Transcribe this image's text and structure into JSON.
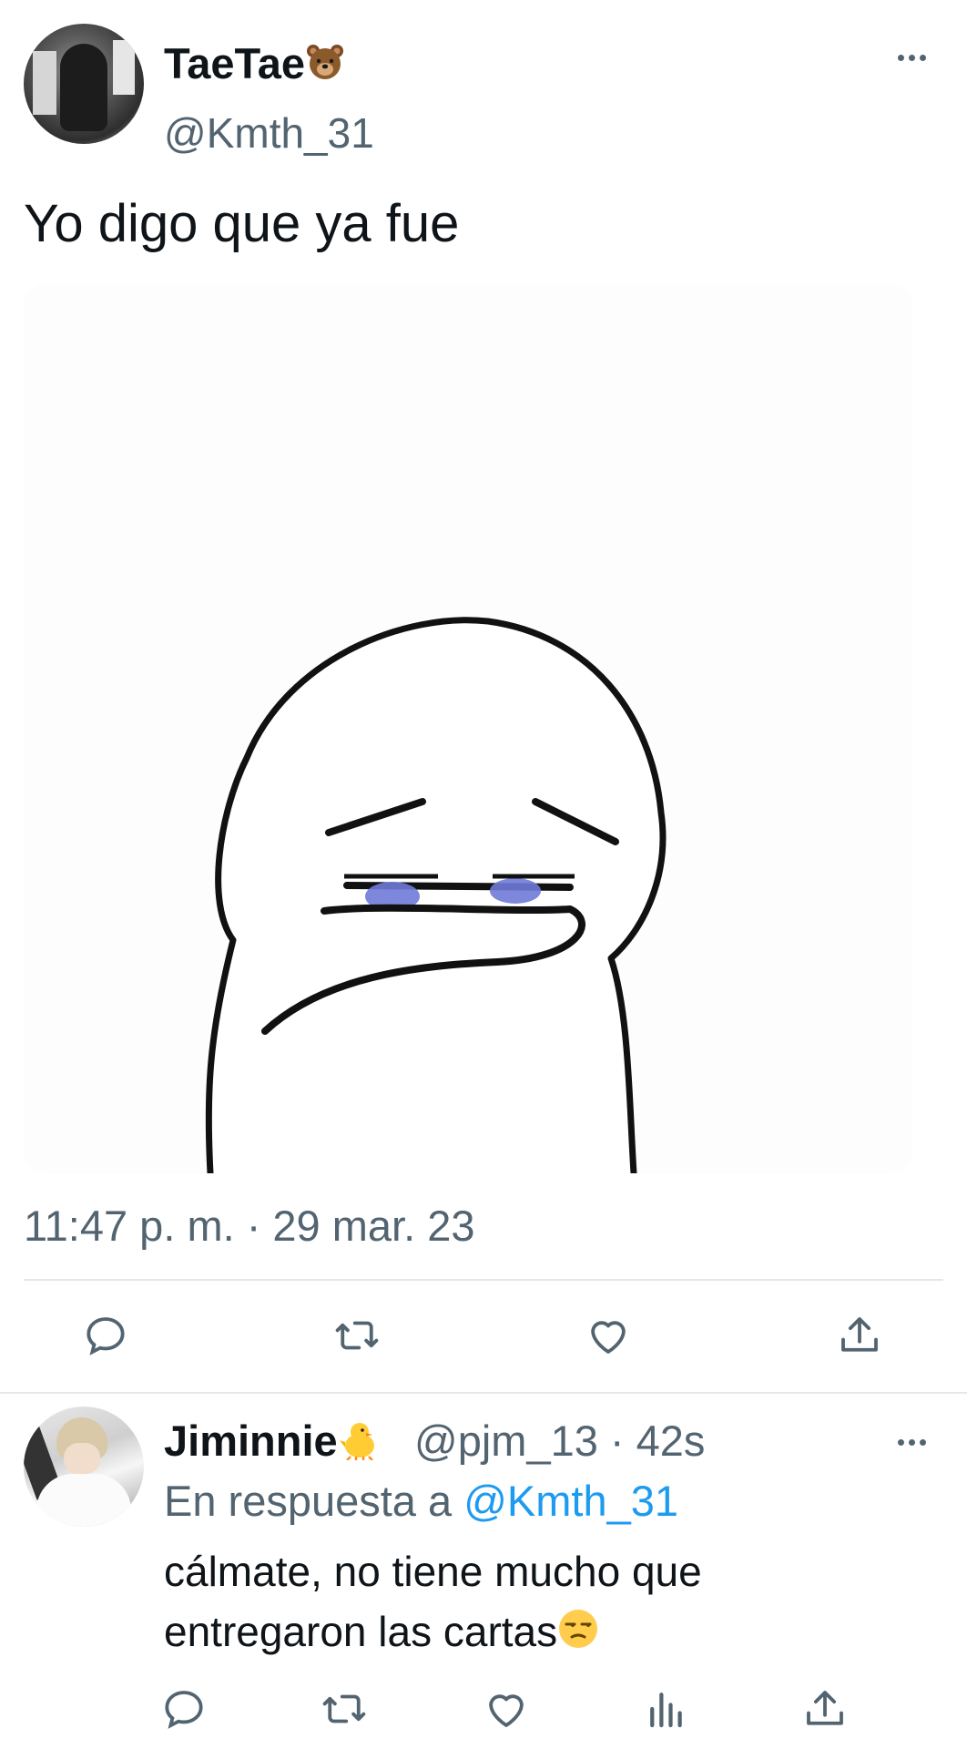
{
  "tweet": {
    "author": {
      "display_name": "TaeTae",
      "name_emoji": "bear-face-emoji",
      "handle": "@Kmth_31"
    },
    "text": "Yo digo que ya fue",
    "media": {
      "description_icon": "crying-meme-character"
    },
    "timestamp": "11:47 p. m. · 29 mar. 23",
    "actions": [
      "reply-icon",
      "retweet-icon",
      "like-icon",
      "share-icon"
    ]
  },
  "reply": {
    "author": {
      "display_name": "Jiminnie",
      "name_emoji": "baby-chick-emoji",
      "handle": "@pjm_13",
      "age": "42s",
      "meta": "@pjm_13 · 42s"
    },
    "context_prefix": "En respuesta a",
    "context_mention": "@Kmth_31",
    "text_line1": "cálmate, no tiene mucho que",
    "text_line2": "entregaron las cartas",
    "text_emoji": "unamused-face-emoji",
    "actions": [
      "reply-icon",
      "retweet-icon",
      "like-icon",
      "views-icon",
      "share-icon"
    ]
  },
  "colors": {
    "text": "#0f1419",
    "secondary": "#536471",
    "link": "#1d9bf0",
    "divider": "#e3e8ec"
  }
}
